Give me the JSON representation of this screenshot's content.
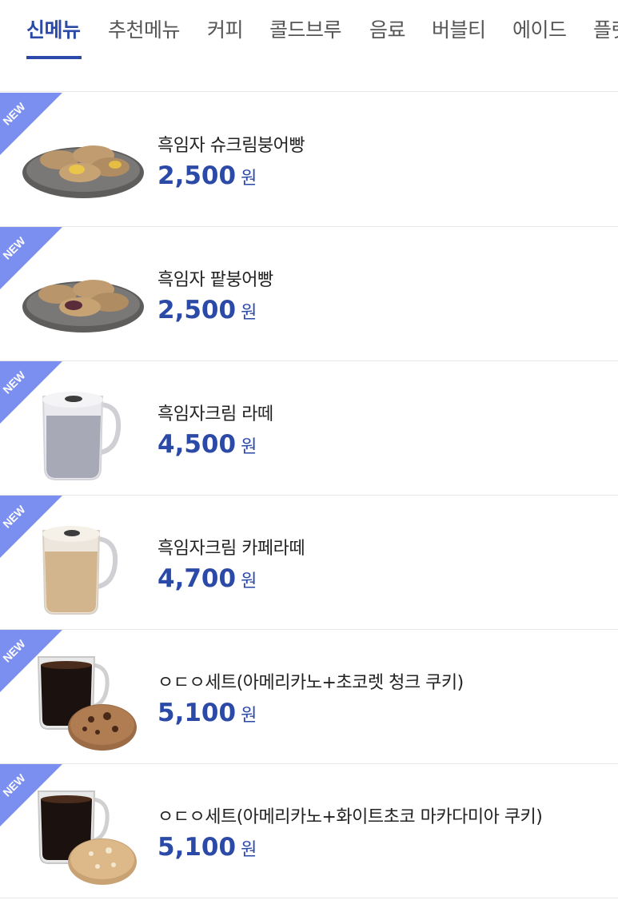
{
  "tabs": [
    {
      "label": "신메뉴",
      "active": true
    },
    {
      "label": "추천메뉴",
      "active": false
    },
    {
      "label": "커피",
      "active": false
    },
    {
      "label": "콜드브루",
      "active": false
    },
    {
      "label": "음료",
      "active": false
    },
    {
      "label": "버블티",
      "active": false
    },
    {
      "label": "에이드",
      "active": false
    },
    {
      "label": "플랫",
      "active": false
    }
  ],
  "badge_text": "NEW",
  "colors": {
    "accent": "#2b4aa8",
    "ribbon": "#7b8ff0"
  },
  "items": [
    {
      "name": "흑임자 슈크림붕어빵",
      "price": "2,500",
      "currency": "원",
      "image": "bungeoppang-cream-plate"
    },
    {
      "name": "흑임자 팥붕어빵",
      "price": "2,500",
      "currency": "원",
      "image": "bungeoppang-redbean-plate"
    },
    {
      "name": "흑임자크림 라떼",
      "price": "4,500",
      "currency": "원",
      "image": "gray-latte-mug"
    },
    {
      "name": "흑임자크림 카페라떼",
      "price": "4,700",
      "currency": "원",
      "image": "cafe-latte-mug"
    },
    {
      "name": "ㅇㄷㅇ세트(아메리카노+초코렛 청크 쿠키)",
      "price": "5,100",
      "currency": "원",
      "image": "americano-choco-cookie"
    },
    {
      "name": "ㅇㄷㅇ세트(아메리카노+화이트초코 마카다미아 쿠키)",
      "price": "5,100",
      "currency": "원",
      "image": "americano-white-cookie"
    }
  ]
}
